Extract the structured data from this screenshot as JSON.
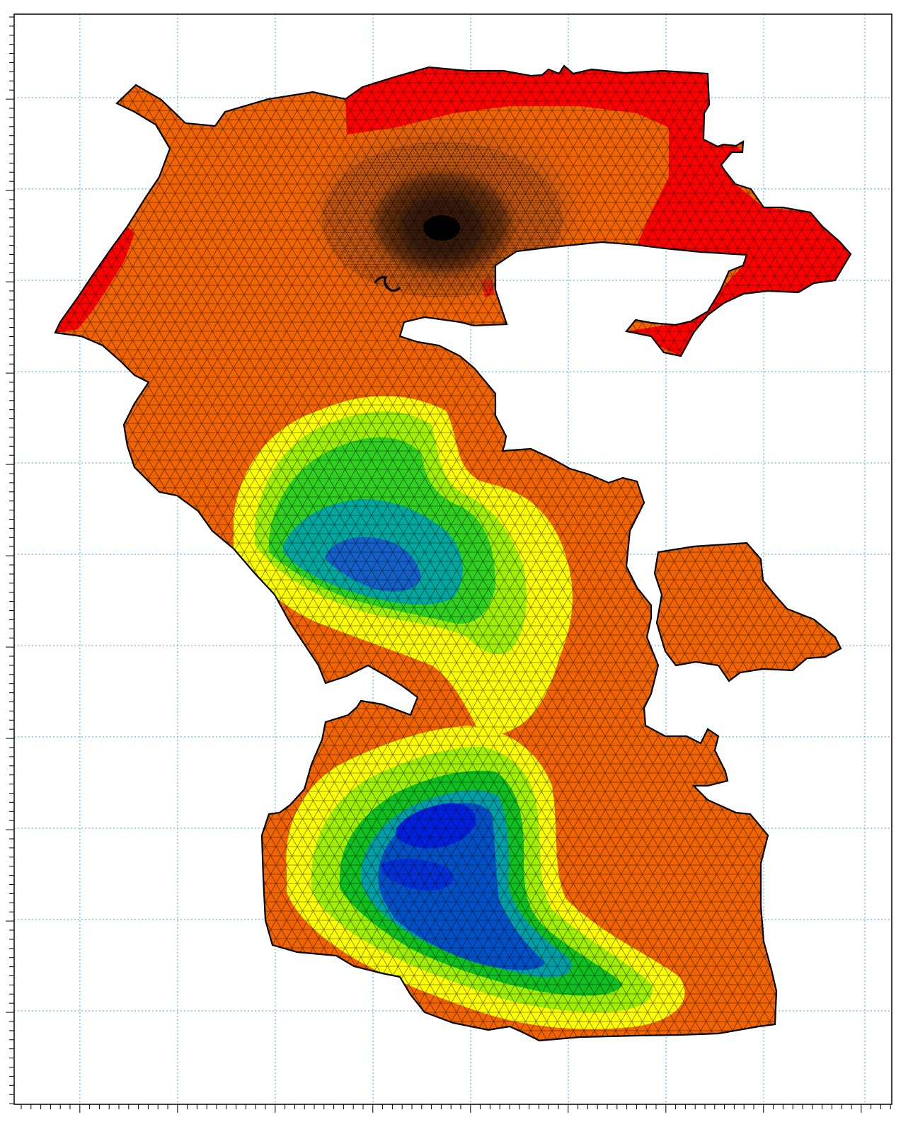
{
  "map": {
    "colors": {
      "background": "#ffffff",
      "frame": "#000000",
      "grid": "#4da3e0",
      "mesh": "#000000",
      "shallow_red": "#ff0000",
      "shallow_orange": "#f26400",
      "dark_core": "#5a2a12",
      "yellow": "#ffff00",
      "light_green": "#90ee20",
      "green": "#00c800",
      "teal": "#00a0a0",
      "deep_blue": "#0050c8",
      "deepest_blue": "#0020e0"
    },
    "grid_style": "dotted",
    "mesh": "triangulated",
    "tick_labels_visible": false
  }
}
